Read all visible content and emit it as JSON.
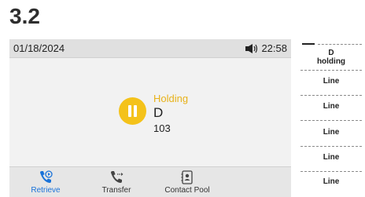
{
  "step": "3.2",
  "status_bar": {
    "date": "01/18/2024",
    "time": "22:58",
    "volume_icon": "speaker-volume-icon"
  },
  "call": {
    "status": "Holding",
    "name": "D",
    "number": "103",
    "status_color": "#e8b21a",
    "hold_icon_color": "#f4c21a"
  },
  "softkeys": [
    {
      "label": "Retrieve",
      "icon": "retrieve-icon",
      "active": true
    },
    {
      "label": "Transfer",
      "icon": "transfer-icon",
      "active": false
    },
    {
      "label": "Contact Pool",
      "icon": "contact-pool-icon",
      "active": false
    }
  ],
  "line_keys": [
    {
      "line1": "D",
      "line2": "holding"
    },
    {
      "line1": "Line"
    },
    {
      "line1": "Line"
    },
    {
      "line1": "Line"
    },
    {
      "line1": "Line"
    },
    {
      "line1": "Line"
    }
  ],
  "accent_color": "#1a73d9"
}
